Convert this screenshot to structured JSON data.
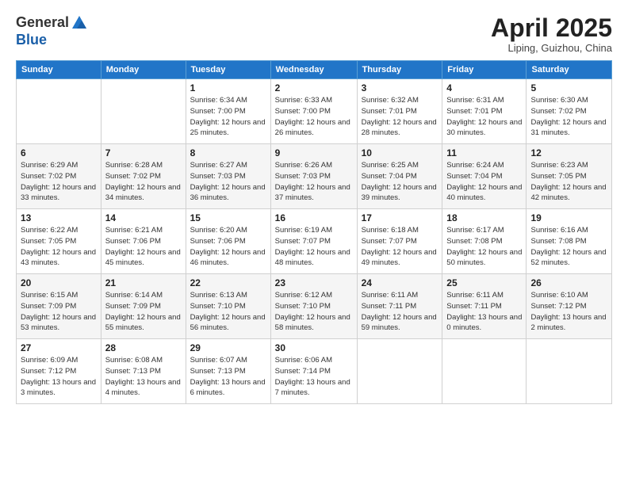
{
  "header": {
    "logo_general": "General",
    "logo_blue": "Blue",
    "month_title": "April 2025",
    "location": "Liping, Guizhou, China"
  },
  "weekdays": [
    "Sunday",
    "Monday",
    "Tuesday",
    "Wednesday",
    "Thursday",
    "Friday",
    "Saturday"
  ],
  "weeks": [
    [
      {
        "day": "",
        "info": ""
      },
      {
        "day": "",
        "info": ""
      },
      {
        "day": "1",
        "info": "Sunrise: 6:34 AM\nSunset: 7:00 PM\nDaylight: 12 hours\nand 25 minutes."
      },
      {
        "day": "2",
        "info": "Sunrise: 6:33 AM\nSunset: 7:00 PM\nDaylight: 12 hours\nand 26 minutes."
      },
      {
        "day": "3",
        "info": "Sunrise: 6:32 AM\nSunset: 7:01 PM\nDaylight: 12 hours\nand 28 minutes."
      },
      {
        "day": "4",
        "info": "Sunrise: 6:31 AM\nSunset: 7:01 PM\nDaylight: 12 hours\nand 30 minutes."
      },
      {
        "day": "5",
        "info": "Sunrise: 6:30 AM\nSunset: 7:02 PM\nDaylight: 12 hours\nand 31 minutes."
      }
    ],
    [
      {
        "day": "6",
        "info": "Sunrise: 6:29 AM\nSunset: 7:02 PM\nDaylight: 12 hours\nand 33 minutes."
      },
      {
        "day": "7",
        "info": "Sunrise: 6:28 AM\nSunset: 7:02 PM\nDaylight: 12 hours\nand 34 minutes."
      },
      {
        "day": "8",
        "info": "Sunrise: 6:27 AM\nSunset: 7:03 PM\nDaylight: 12 hours\nand 36 minutes."
      },
      {
        "day": "9",
        "info": "Sunrise: 6:26 AM\nSunset: 7:03 PM\nDaylight: 12 hours\nand 37 minutes."
      },
      {
        "day": "10",
        "info": "Sunrise: 6:25 AM\nSunset: 7:04 PM\nDaylight: 12 hours\nand 39 minutes."
      },
      {
        "day": "11",
        "info": "Sunrise: 6:24 AM\nSunset: 7:04 PM\nDaylight: 12 hours\nand 40 minutes."
      },
      {
        "day": "12",
        "info": "Sunrise: 6:23 AM\nSunset: 7:05 PM\nDaylight: 12 hours\nand 42 minutes."
      }
    ],
    [
      {
        "day": "13",
        "info": "Sunrise: 6:22 AM\nSunset: 7:05 PM\nDaylight: 12 hours\nand 43 minutes."
      },
      {
        "day": "14",
        "info": "Sunrise: 6:21 AM\nSunset: 7:06 PM\nDaylight: 12 hours\nand 45 minutes."
      },
      {
        "day": "15",
        "info": "Sunrise: 6:20 AM\nSunset: 7:06 PM\nDaylight: 12 hours\nand 46 minutes."
      },
      {
        "day": "16",
        "info": "Sunrise: 6:19 AM\nSunset: 7:07 PM\nDaylight: 12 hours\nand 48 minutes."
      },
      {
        "day": "17",
        "info": "Sunrise: 6:18 AM\nSunset: 7:07 PM\nDaylight: 12 hours\nand 49 minutes."
      },
      {
        "day": "18",
        "info": "Sunrise: 6:17 AM\nSunset: 7:08 PM\nDaylight: 12 hours\nand 50 minutes."
      },
      {
        "day": "19",
        "info": "Sunrise: 6:16 AM\nSunset: 7:08 PM\nDaylight: 12 hours\nand 52 minutes."
      }
    ],
    [
      {
        "day": "20",
        "info": "Sunrise: 6:15 AM\nSunset: 7:09 PM\nDaylight: 12 hours\nand 53 minutes."
      },
      {
        "day": "21",
        "info": "Sunrise: 6:14 AM\nSunset: 7:09 PM\nDaylight: 12 hours\nand 55 minutes."
      },
      {
        "day": "22",
        "info": "Sunrise: 6:13 AM\nSunset: 7:10 PM\nDaylight: 12 hours\nand 56 minutes."
      },
      {
        "day": "23",
        "info": "Sunrise: 6:12 AM\nSunset: 7:10 PM\nDaylight: 12 hours\nand 58 minutes."
      },
      {
        "day": "24",
        "info": "Sunrise: 6:11 AM\nSunset: 7:11 PM\nDaylight: 12 hours\nand 59 minutes."
      },
      {
        "day": "25",
        "info": "Sunrise: 6:11 AM\nSunset: 7:11 PM\nDaylight: 13 hours\nand 0 minutes."
      },
      {
        "day": "26",
        "info": "Sunrise: 6:10 AM\nSunset: 7:12 PM\nDaylight: 13 hours\nand 2 minutes."
      }
    ],
    [
      {
        "day": "27",
        "info": "Sunrise: 6:09 AM\nSunset: 7:12 PM\nDaylight: 13 hours\nand 3 minutes."
      },
      {
        "day": "28",
        "info": "Sunrise: 6:08 AM\nSunset: 7:13 PM\nDaylight: 13 hours\nand 4 minutes."
      },
      {
        "day": "29",
        "info": "Sunrise: 6:07 AM\nSunset: 7:13 PM\nDaylight: 13 hours\nand 6 minutes."
      },
      {
        "day": "30",
        "info": "Sunrise: 6:06 AM\nSunset: 7:14 PM\nDaylight: 13 hours\nand 7 minutes."
      },
      {
        "day": "",
        "info": ""
      },
      {
        "day": "",
        "info": ""
      },
      {
        "day": "",
        "info": ""
      }
    ]
  ]
}
